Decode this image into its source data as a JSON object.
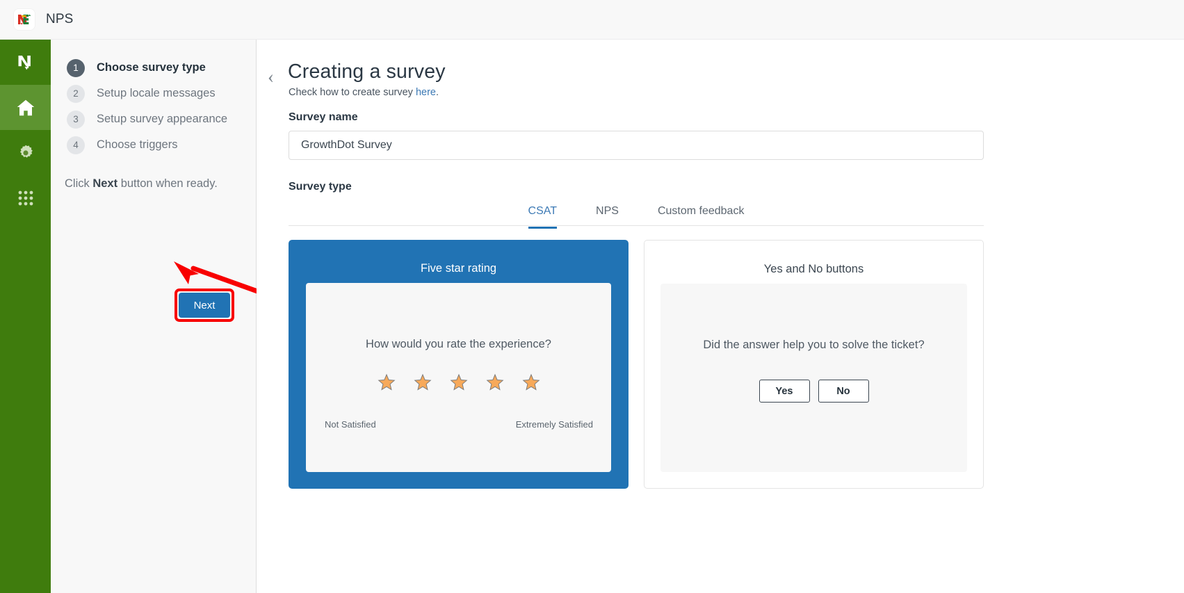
{
  "topbar": {
    "logo_icon": "ns-logo-icon",
    "title": "NPS"
  },
  "rail": {
    "items": [
      {
        "icon": "nps-brand-n-icon",
        "name": "brand-logo",
        "active": false
      },
      {
        "icon": "home-icon",
        "name": "home",
        "active": true
      },
      {
        "icon": "gear-icon",
        "name": "settings",
        "active": false
      },
      {
        "icon": "apps-grid-icon",
        "name": "apps",
        "active": false
      }
    ]
  },
  "steps_panel": {
    "steps": [
      {
        "number": "1",
        "label": "Choose survey type",
        "active": true
      },
      {
        "number": "2",
        "label": "Setup locale messages",
        "active": false
      },
      {
        "number": "3",
        "label": "Setup survey appearance",
        "active": false
      },
      {
        "number": "4",
        "label": "Choose triggers",
        "active": false
      }
    ],
    "hint_prefix": "Click ",
    "hint_bold": "Next",
    "hint_suffix": " button when ready.",
    "next_label": "Next",
    "next_button_color": "#2173b4",
    "highlight_color": "#f80000"
  },
  "main": {
    "back_icon": "chevron-left-icon",
    "heading": "Creating a survey",
    "sub_prefix": "Check how to create survey ",
    "sub_link": "here",
    "sub_suffix": ".",
    "link_color": "#3d7ab5",
    "survey_name_label": "Survey name",
    "survey_name_value": "GrowthDot Survey",
    "survey_name_placeholder": "Survey name",
    "survey_type_label": "Survey type",
    "tabs": [
      {
        "label": "CSAT",
        "active": true
      },
      {
        "label": "NPS",
        "active": false
      },
      {
        "label": "Custom feedback",
        "active": false
      }
    ],
    "accent_color": "#2173b4",
    "cards": [
      {
        "title": "Five star rating",
        "selected": true,
        "question": "How would you rate the experience?",
        "star_count": 5,
        "star_color": "#f7a95a",
        "scale_low": "Not Satisfied",
        "scale_high": "Extremely Satisfied"
      },
      {
        "title": "Yes and No buttons",
        "selected": false,
        "question": "Did the answer help you to solve the ticket?",
        "buttons": [
          "Yes",
          "No"
        ]
      }
    ]
  }
}
